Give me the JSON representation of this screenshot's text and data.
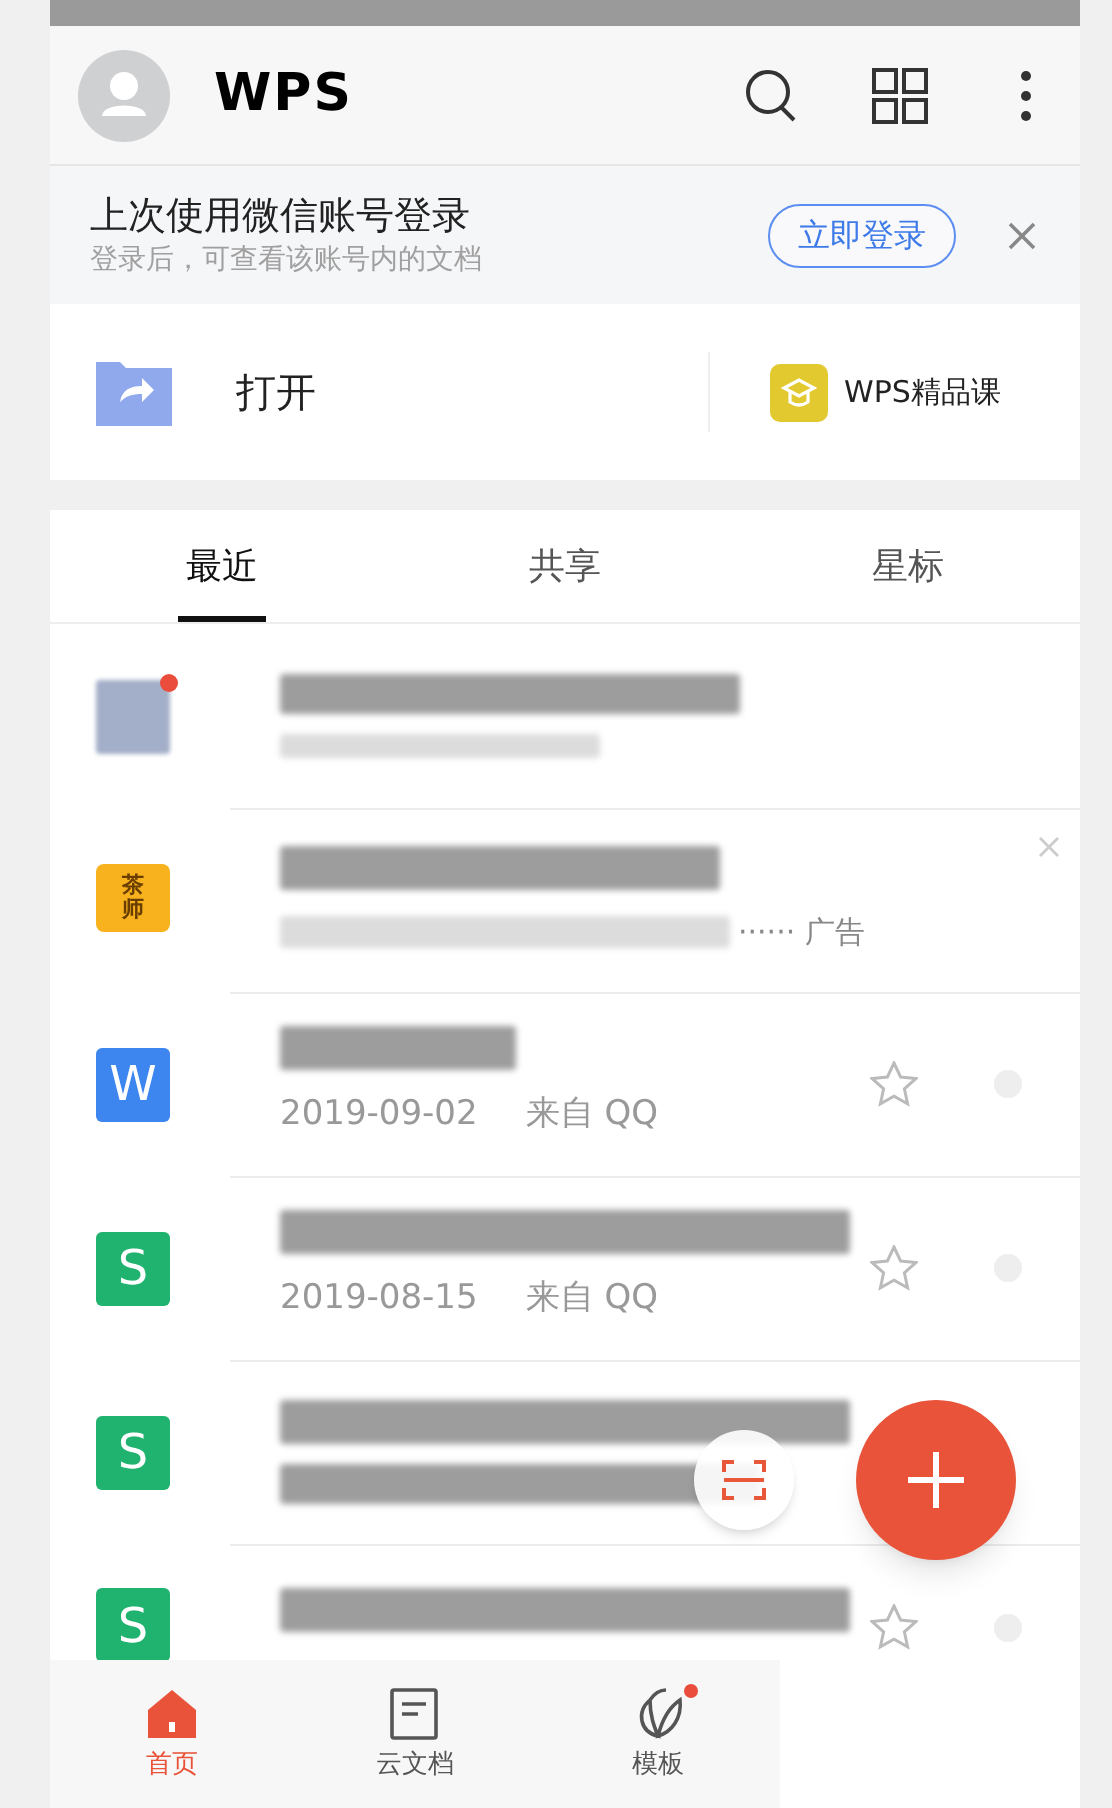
{
  "header": {
    "logo": "WPS"
  },
  "login_banner": {
    "title": "上次使用微信账号登录",
    "subtitle": "登录后，可查看该账号内的文档",
    "button": "立即登录"
  },
  "quick_actions": [
    {
      "kind": "open",
      "label": "打开"
    },
    {
      "kind": "course",
      "label": "WPS精品课"
    }
  ],
  "tabs": [
    {
      "label": "最近",
      "selected": true
    },
    {
      "label": "共享",
      "selected": false
    },
    {
      "label": "星标",
      "selected": false
    }
  ],
  "files": [
    {
      "kind": "folder",
      "unread": true
    },
    {
      "kind": "ad",
      "icon_text": "茶师",
      "tag": "······ 广告"
    },
    {
      "kind": "doc",
      "icon_text": "W",
      "color": "#3d86f0",
      "date": "2019-09-02",
      "source": "来自 QQ",
      "starred": false
    },
    {
      "kind": "doc",
      "icon_text": "S",
      "color": "#20b36f",
      "date": "2019-08-15",
      "source": "来自 QQ",
      "starred": false
    },
    {
      "kind": "doc",
      "icon_text": "S",
      "color": "#20b36f"
    },
    {
      "kind": "doc",
      "icon_text": "S",
      "color": "#20b36f",
      "starred": false
    }
  ],
  "bottom_nav": [
    {
      "label": "首页",
      "selected": true,
      "badge": false
    },
    {
      "label": "云文档",
      "selected": false,
      "badge": false
    },
    {
      "label": "模板",
      "selected": false,
      "badge": true
    }
  ]
}
